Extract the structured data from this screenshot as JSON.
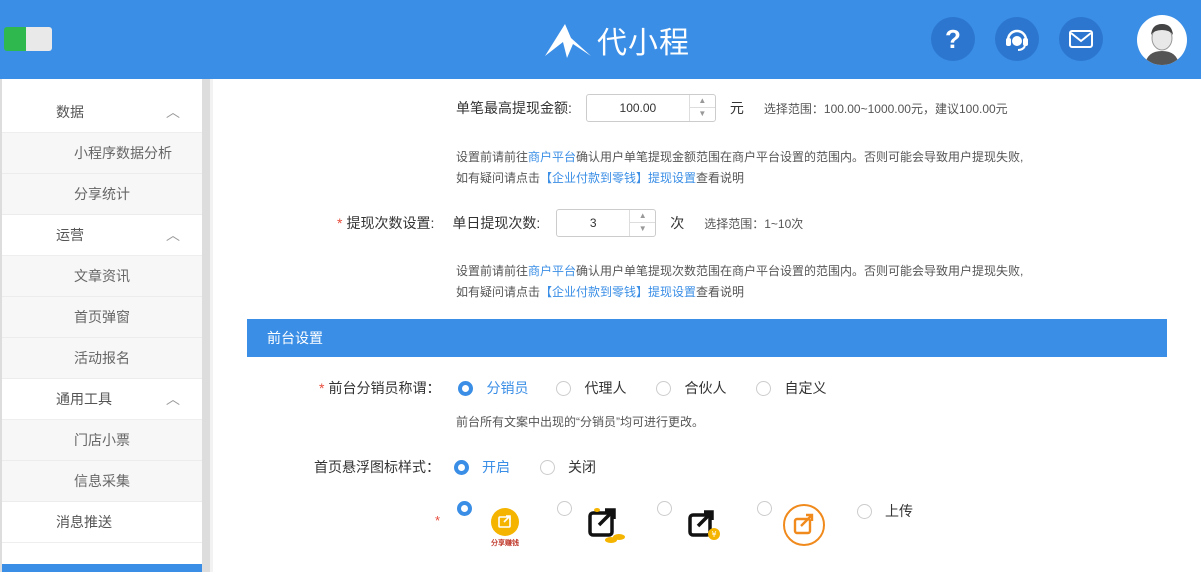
{
  "header": {
    "logo_text": "代小程",
    "icons": [
      "question-icon",
      "customer-service-icon",
      "mail-icon",
      "avatar"
    ],
    "question_glyph": "?"
  },
  "sidebar": {
    "groups": [
      {
        "label": "数据",
        "items": [
          "小程序数据分析",
          "分享统计"
        ]
      },
      {
        "label": "运营",
        "items": [
          "文章资讯",
          "首页弹窗",
          "活动报名"
        ]
      },
      {
        "label": "通用工具",
        "items": [
          "门店小票",
          "信息采集"
        ]
      }
    ],
    "single": "消息推送",
    "chevron": "︿"
  },
  "withdraw": {
    "max_label": "单笔最高提现金额:",
    "max_value": "100.00",
    "max_unit": "元",
    "max_range": "选择范围：100.00~1000.00元，建议100.00元",
    "tip1_pre": "设置前请前往",
    "tip1_link": "商户平台",
    "tip1_post": "确认用户单笔提现金额范围在商户平台设置的范围内。否则可能会导致用户提现失败,",
    "tip_line2_pre": "如有疑问请点击",
    "tip_line2_link": "【企业付款到零钱】提现设置",
    "tip_line2_post": "查看说明",
    "count_title": "提现次数设置:",
    "count_label": "单日提现次数:",
    "count_value": "3",
    "count_unit": "次",
    "count_range": "选择范围：1~10次",
    "tip2_post": "确认用户单笔提现次数范围在商户平台设置的范围内。否则可能会导致用户提现失败,"
  },
  "front": {
    "section_title": "前台设置",
    "title_label": "前台分销员称谓：",
    "title_options": [
      "分销员",
      "代理人",
      "合伙人",
      "自定义"
    ],
    "title_note": "前台所有文案中出现的“分销员”均可进行更改。",
    "float_label": "首页悬浮图标样式：",
    "float_options": [
      "开启",
      "关闭"
    ],
    "icon_caption": "分享赚钱",
    "upload_label": "上传"
  },
  "colors": {
    "primary": "#3a8ee6",
    "required": "#e74c3c",
    "coin": "#f5b400"
  }
}
